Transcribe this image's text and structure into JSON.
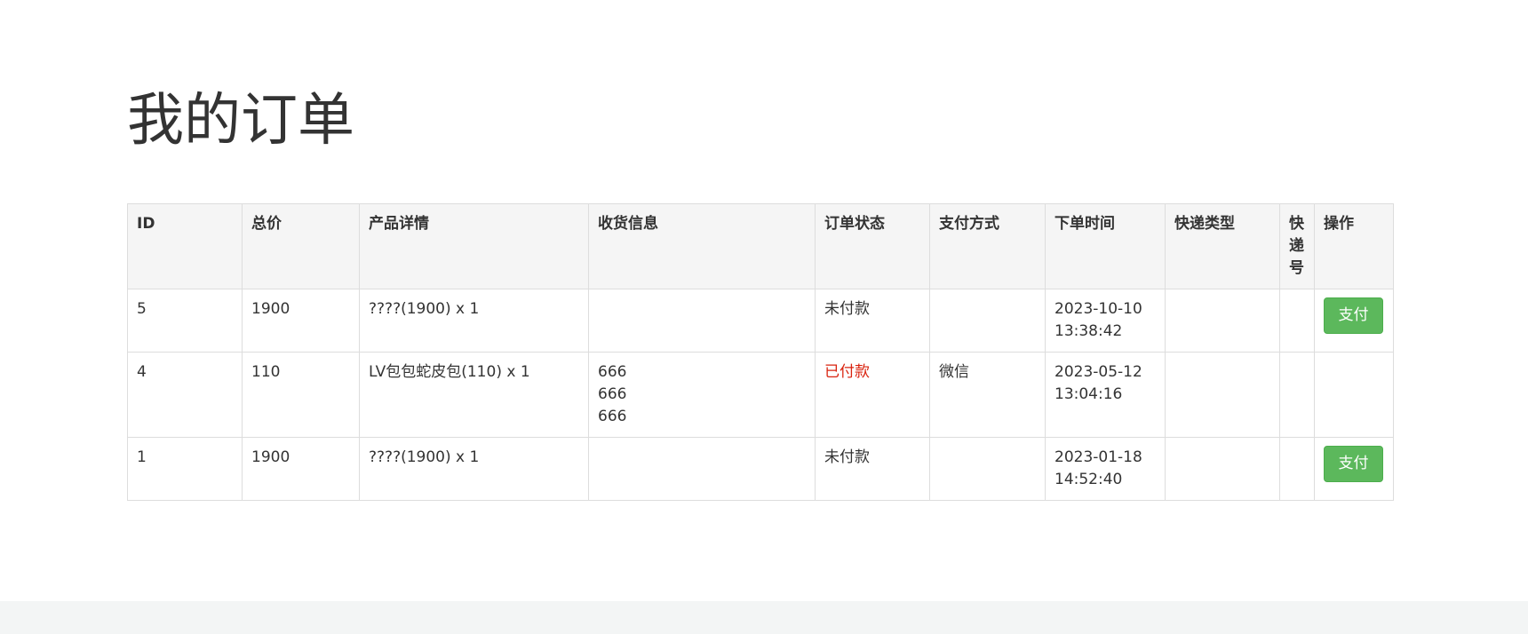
{
  "page": {
    "title": "我的订单"
  },
  "table": {
    "headers": [
      "ID",
      "总价",
      "产品详情",
      "收货信息",
      "订单状态",
      "支付方式",
      "下单时间",
      "快递类型",
      "快递号",
      "操作"
    ],
    "rows": [
      {
        "id": "5",
        "total": "1900",
        "product": "????(1900) x 1",
        "shipping": [],
        "status": "未付款",
        "payment": "",
        "time_date": "2023-10-10",
        "time_clock": "13:38:42",
        "express_type": "",
        "express_no": "",
        "action": "支付"
      },
      {
        "id": "4",
        "total": "110",
        "product": "LV包包蛇皮包(110) x 1",
        "shipping": [
          "666",
          "666",
          "666"
        ],
        "status": "已付款",
        "payment": "微信",
        "time_date": "2023-05-12",
        "time_clock": "13:04:16",
        "express_type": "",
        "express_no": "",
        "action": ""
      },
      {
        "id": "1",
        "total": "1900",
        "product": "????(1900) x 1",
        "shipping": [],
        "status": "未付款",
        "payment": "",
        "time_date": "2023-01-18",
        "time_clock": "14:52:40",
        "express_type": "",
        "express_no": "",
        "action": "支付"
      }
    ]
  },
  "colors": {
    "paid_status": "#d9230f",
    "pay_button": "#5cb85c",
    "header_bg": "#f5f5f5",
    "footer_bg": "#f3f5f5"
  }
}
